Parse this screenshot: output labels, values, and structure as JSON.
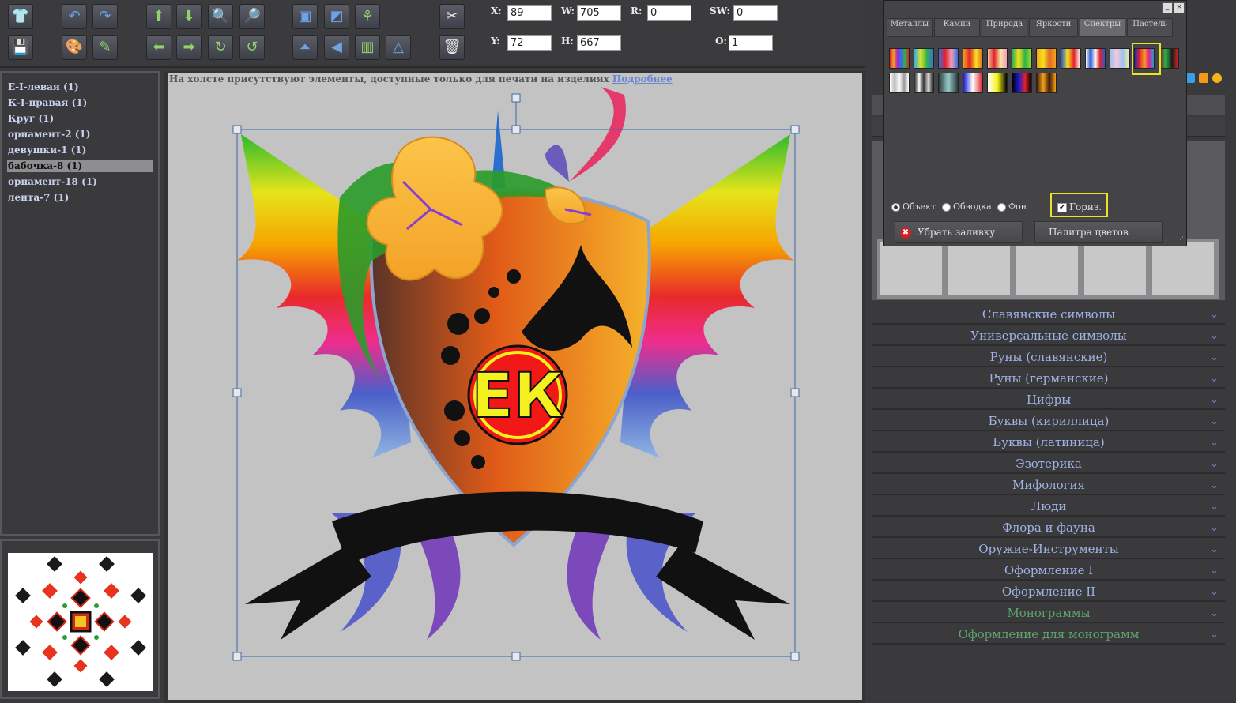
{
  "toolbar": {
    "icons": [
      "tshirt-icon",
      "undo-icon",
      "redo-icon",
      "move-up-icon",
      "move-down-icon",
      "zoom-in-icon",
      "zoom-out-icon",
      "front-icon",
      "back-icon",
      "align-icon",
      "settings-icon",
      "save-icon",
      "palette-icon",
      "edit-icon",
      "move-left-icon",
      "move-right-icon",
      "rotate-cw-icon",
      "rotate-ccw-icon",
      "flip-vertical-icon",
      "flip-horizontal-icon",
      "group-icon",
      "triangle-icon",
      "delete-icon"
    ],
    "coords": {
      "x_label": "X:",
      "x_value": "89",
      "y_label": "Y:",
      "y_value": "72",
      "w_label": "W:",
      "w_value": "705",
      "h_label": "H:",
      "h_value": "667",
      "r_label": "R:",
      "r_value": "0",
      "sw_label": "SW:",
      "sw_value": "0",
      "o_label": "O:",
      "o_value": "1"
    }
  },
  "layers": [
    {
      "label": "Е-I-левая (1)"
    },
    {
      "label": "К-I-правая (1)"
    },
    {
      "label": "Круг (1)"
    },
    {
      "label": "орнамент-2 (1)"
    },
    {
      "label": "девушки-1 (1)"
    },
    {
      "label": "бабочка-8 (1)"
    },
    {
      "label": "орнамент-18 (1)"
    },
    {
      "label": "лента-7 (1)"
    }
  ],
  "canvas": {
    "notice": "На холсте присутствуют элементы, доступные только для печати на изделиях",
    "notice_link": "Подробнее",
    "monogram": "ЕК"
  },
  "palette": {
    "tabs": [
      "Металлы",
      "Камни",
      "Природа",
      "Яркости",
      "Спектры",
      "Пастель"
    ],
    "active_tab": "Спектры",
    "target_options": [
      "Объект",
      "Обводка",
      "Фон"
    ],
    "selected_target": "Объект",
    "horizontal_label": "Гориз.",
    "remove_fill": "Убрать заливку",
    "color_palette": "Палитра цветов"
  },
  "categories": [
    {
      "label": "Славянские символы"
    },
    {
      "label": "Универсальные символы"
    },
    {
      "label": "Руны (славянские)"
    },
    {
      "label": "Руны (германские)"
    },
    {
      "label": "Цифры"
    },
    {
      "label": "Буквы (кириллица)"
    },
    {
      "label": "Буквы (латиница)"
    },
    {
      "label": "Эзотерика"
    },
    {
      "label": "Мифология"
    },
    {
      "label": "Люди"
    },
    {
      "label": "Флора и фауна"
    },
    {
      "label": "Оружие-Инструменты"
    },
    {
      "label": "Оформление I"
    },
    {
      "label": "Оформление II"
    },
    {
      "label": "Монограммы"
    },
    {
      "label": "Оформление для монограмм"
    }
  ],
  "colors": {
    "accent_highlight": "#ece12b",
    "category_text": "#9fb3e4",
    "category_green": "#5ea46a"
  }
}
